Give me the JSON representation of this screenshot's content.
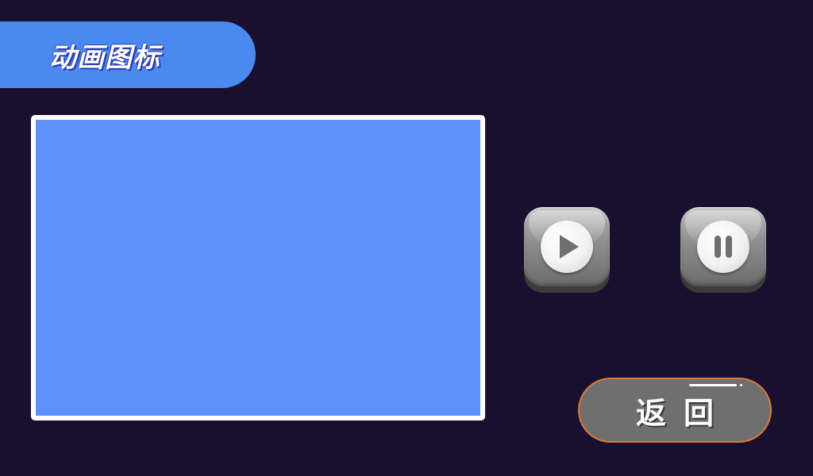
{
  "header": {
    "title": "动画图标"
  },
  "animation_area": {
    "background_color": "#5f91fc"
  },
  "controls": {
    "play_icon": "play-icon",
    "pause_icon": "pause-icon"
  },
  "footer": {
    "back_label": "返回"
  },
  "colors": {
    "background": "#190f2e",
    "title_tab": "#4a8af0",
    "button_border": "#e07a2e"
  }
}
